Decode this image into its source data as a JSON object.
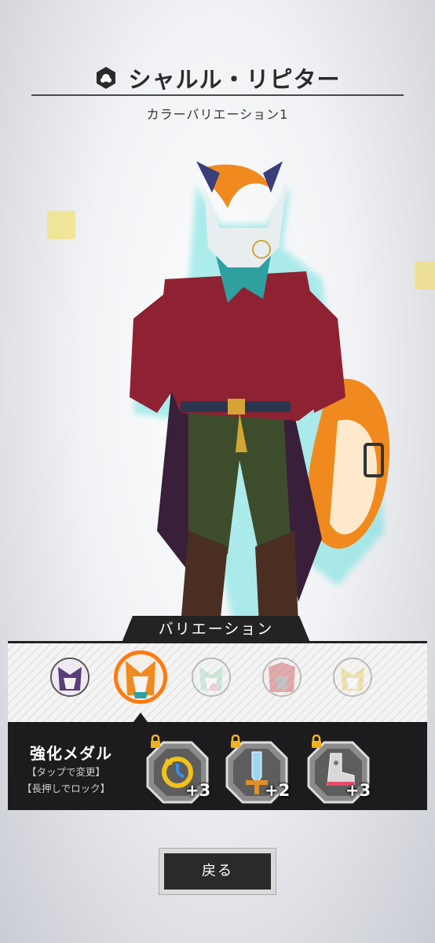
{
  "header": {
    "character_name": "シャルル・リピター",
    "variation_caption": "カラーバリエーション1",
    "title_icon": "character-badge-icon"
  },
  "variation": {
    "label": "バリエーション",
    "selected_index": 1,
    "items_count_shown": 5
  },
  "medals": {
    "title": "強化メダル",
    "hint_tap": "【タップで変更】",
    "hint_hold": "【長押しでロック】",
    "items": [
      {
        "icon": "clock-arrow-icon",
        "bonus": "+3",
        "locked": true
      },
      {
        "icon": "sword-icon",
        "bonus": "+2",
        "locked": true
      },
      {
        "icon": "boot-icon",
        "bonus": "+3",
        "locked": true
      }
    ]
  },
  "back_button": {
    "label": "戻る"
  },
  "colors": {
    "accent": "#ff7a0e",
    "panel": "#1c1c1e",
    "lock": "#f2b21c"
  }
}
